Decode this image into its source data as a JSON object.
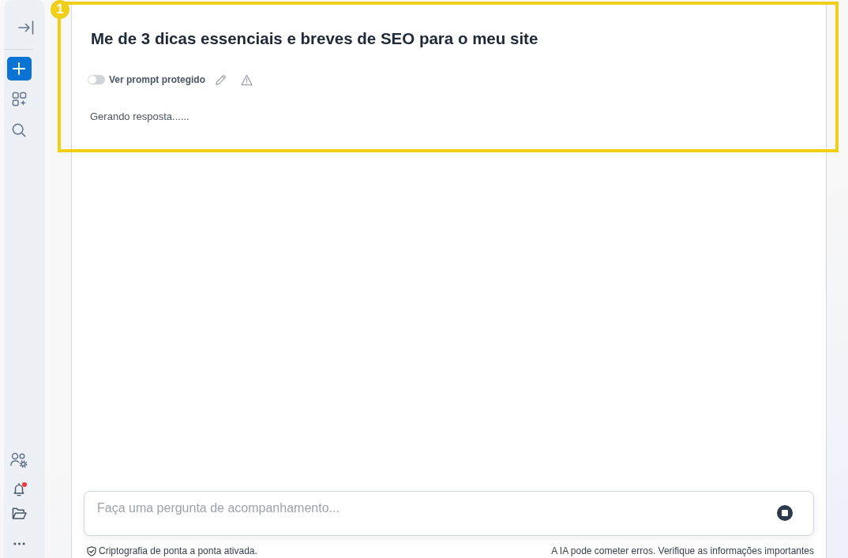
{
  "sidebar": {
    "alerts_unread": true
  },
  "highlight": {
    "badge": "1"
  },
  "conversation": {
    "title": "Me de 3 dicas essenciais e breves de SEO para o meu site",
    "protected_prompt": {
      "label": "Ver prompt protegido",
      "on": false
    },
    "status": "Gerando resposta......"
  },
  "composer": {
    "placeholder": "Faça uma pergunta de acompanhamento...",
    "action": {
      "kind": "stop"
    }
  },
  "footer": {
    "left": "Criptografia de ponta a ponta ativada.",
    "right": "A IA pode cometer erros. Verifique as informações importantes"
  }
}
